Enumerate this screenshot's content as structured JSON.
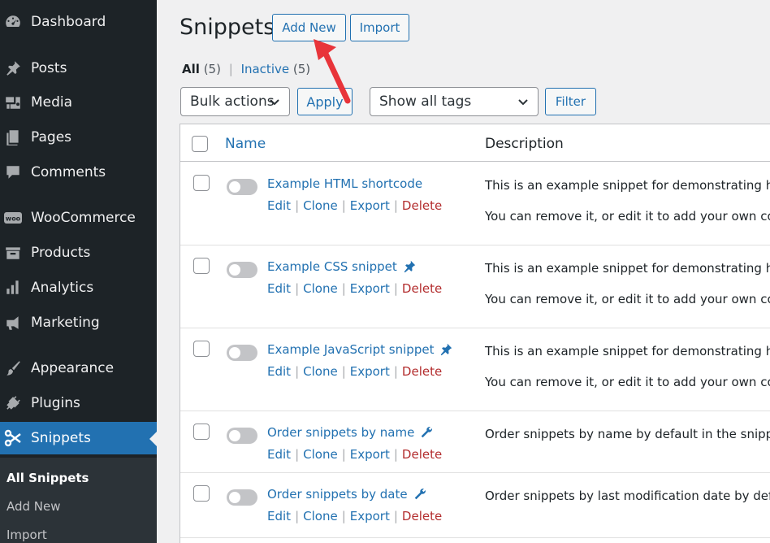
{
  "sidebar": {
    "items": [
      {
        "label": "Dashboard",
        "icon": "dashboard-icon"
      },
      {
        "label": "Posts",
        "icon": "pin-icon"
      },
      {
        "label": "Media",
        "icon": "media-icon"
      },
      {
        "label": "Pages",
        "icon": "pages-icon"
      },
      {
        "label": "Comments",
        "icon": "comments-icon"
      },
      {
        "label": "WooCommerce",
        "icon": "woo-icon"
      },
      {
        "label": "Products",
        "icon": "products-icon"
      },
      {
        "label": "Analytics",
        "icon": "analytics-icon"
      },
      {
        "label": "Marketing",
        "icon": "megaphone-icon"
      },
      {
        "label": "Appearance",
        "icon": "brush-icon"
      },
      {
        "label": "Plugins",
        "icon": "plug-icon"
      },
      {
        "label": "Snippets",
        "icon": "scissors-icon"
      }
    ],
    "submenu": [
      "All Snippets",
      "Add New",
      "Import"
    ]
  },
  "header": {
    "title": "Snippets",
    "add_new_label": "Add New",
    "import_label": "Import"
  },
  "views": {
    "all_label": "All",
    "all_count": "(5)",
    "separator": "|",
    "inactive_label": "Inactive",
    "inactive_count": "(5)"
  },
  "toolbar": {
    "bulk_actions": "Bulk actions",
    "apply_label": "Apply",
    "tags_select": "Show all tags",
    "filter_label": "Filter"
  },
  "table": {
    "col_name": "Name",
    "col_description": "Description",
    "action_edit": "Edit",
    "action_clone": "Clone",
    "action_export": "Export",
    "action_delete": "Delete",
    "rows": [
      {
        "name": "Example HTML shortcode",
        "desc1": "This is an example snippet for demonstrating how",
        "desc2": "You can remove it, or edit it to add your own cont",
        "icon": ""
      },
      {
        "name": "Example CSS snippet",
        "desc1": "This is an example snippet for demonstrating how",
        "desc2": "You can remove it, or edit it to add your own cont",
        "icon": "pin-icon"
      },
      {
        "name": "Example JavaScript snippet",
        "desc1": "This is an example snippet for demonstrating how",
        "desc2": "You can remove it, or edit it to add your own cont",
        "icon": "pin-icon"
      },
      {
        "name": "Order snippets by name",
        "desc1": "Order snippets by name by default in the snippet",
        "desc2": "",
        "icon": "wrench-icon"
      },
      {
        "name": "Order snippets by date",
        "desc1": "Order snippets by last modification date by defau",
        "desc2": "",
        "icon": "wrench-icon"
      }
    ]
  },
  "colors": {
    "accent": "#2271b1",
    "sidebar_bg": "#1d2327",
    "delete": "#b32d2e",
    "annotation": "#e8343a"
  }
}
